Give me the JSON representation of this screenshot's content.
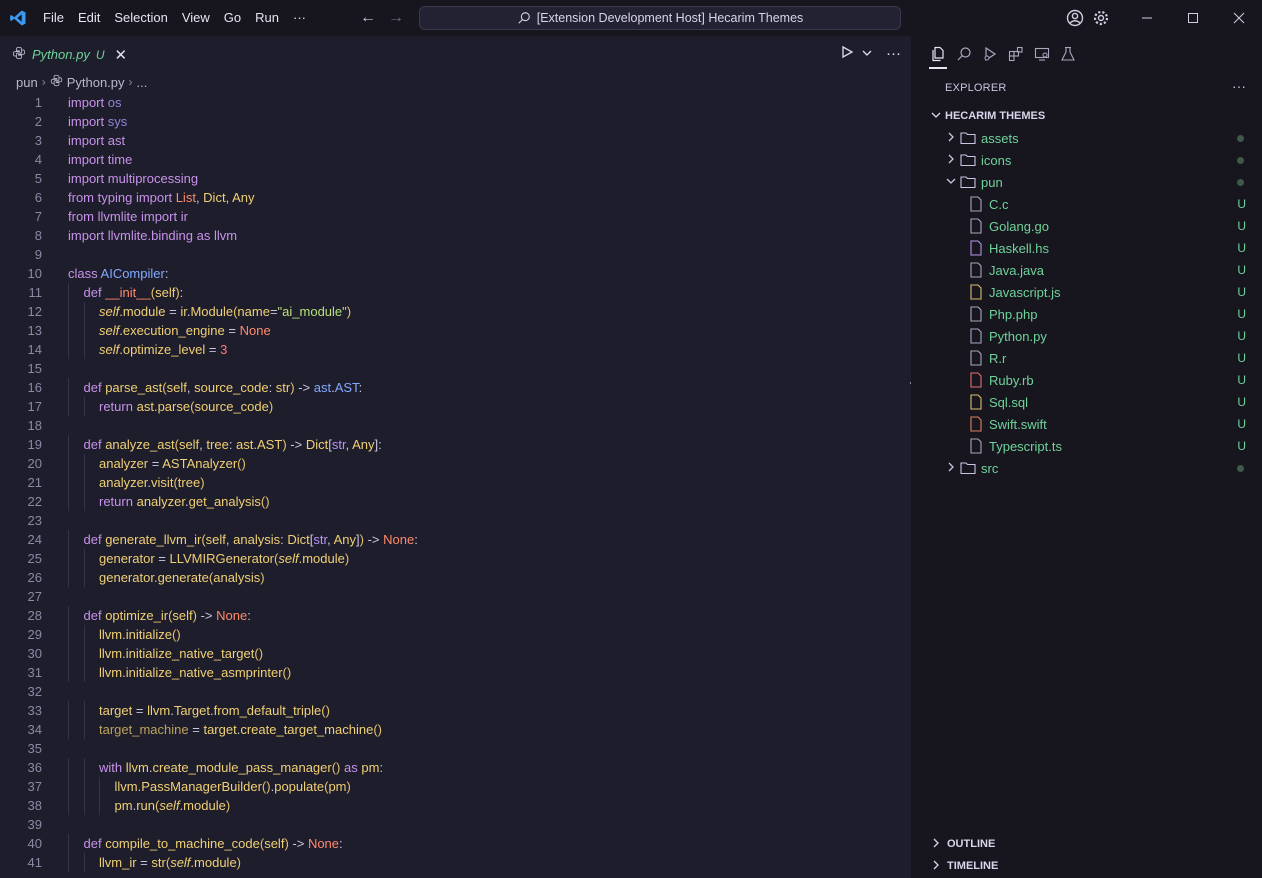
{
  "menu": [
    "File",
    "Edit",
    "Selection",
    "View",
    "Go",
    "Run",
    "···"
  ],
  "command_center": "[Extension Development Host] Hecarim Themes",
  "tab": {
    "label": "Python.py",
    "badge": "U"
  },
  "breadcrumb": [
    "pun",
    "Python.py",
    "..."
  ],
  "explorer": {
    "title": "EXPLORER",
    "root": "HECARIM THEMES",
    "items": [
      {
        "label": "assets",
        "type": "folder",
        "expanded": false
      },
      {
        "label": "icons",
        "type": "folder",
        "expanded": false
      },
      {
        "label": "pun",
        "type": "folder",
        "expanded": true
      },
      {
        "label": "C.c",
        "type": "file",
        "badge": "U"
      },
      {
        "label": "Golang.go",
        "type": "file",
        "badge": "U"
      },
      {
        "label": "Haskell.hs",
        "type": "file",
        "badge": "U"
      },
      {
        "label": "Java.java",
        "type": "file",
        "badge": "U"
      },
      {
        "label": "Javascript.js",
        "type": "file",
        "badge": "U"
      },
      {
        "label": "Php.php",
        "type": "file",
        "badge": "U"
      },
      {
        "label": "Python.py",
        "type": "file",
        "badge": "U"
      },
      {
        "label": "R.r",
        "type": "file",
        "badge": "U"
      },
      {
        "label": "Ruby.rb",
        "type": "file",
        "badge": "U"
      },
      {
        "label": "Sql.sql",
        "type": "file",
        "badge": "U"
      },
      {
        "label": "Swift.swift",
        "type": "file",
        "badge": "U"
      },
      {
        "label": "Typescript.ts",
        "type": "file",
        "badge": "U"
      },
      {
        "label": "src",
        "type": "folder",
        "expanded": false
      }
    ],
    "sections": [
      "OUTLINE",
      "TIMELINE"
    ]
  },
  "code_lines": [
    {
      "n": "1",
      "indent": 0,
      "t": [
        [
          "kw",
          "import"
        ],
        [
          "op",
          " "
        ],
        [
          "mod",
          "os"
        ]
      ]
    },
    {
      "n": "2",
      "indent": 0,
      "t": [
        [
          "kw",
          "import"
        ],
        [
          "op",
          " "
        ],
        [
          "mod",
          "sys"
        ]
      ]
    },
    {
      "n": "3",
      "indent": 0,
      "t": [
        [
          "kw",
          "import"
        ],
        [
          "op",
          " "
        ],
        [
          "kw",
          "ast"
        ]
      ]
    },
    {
      "n": "4",
      "indent": 0,
      "t": [
        [
          "kw",
          "import"
        ],
        [
          "op",
          " "
        ],
        [
          "kw",
          "time"
        ]
      ]
    },
    {
      "n": "5",
      "indent": 0,
      "t": [
        [
          "kw",
          "import"
        ],
        [
          "op",
          " "
        ],
        [
          "kw",
          "multiprocessing"
        ]
      ]
    },
    {
      "n": "6",
      "indent": 0,
      "t": [
        [
          "kw",
          "from"
        ],
        [
          "op",
          " "
        ],
        [
          "kw",
          "typing"
        ],
        [
          "op",
          " "
        ],
        [
          "kw",
          "import"
        ],
        [
          "op",
          " "
        ],
        [
          "nn",
          "List"
        ],
        [
          "op",
          ", "
        ],
        [
          "fn",
          "Dict"
        ],
        [
          "op",
          ", "
        ],
        [
          "fn",
          "Any"
        ]
      ]
    },
    {
      "n": "7",
      "indent": 0,
      "t": [
        [
          "kw",
          "from"
        ],
        [
          "op",
          " "
        ],
        [
          "kw",
          "llvmlite"
        ],
        [
          "op",
          " "
        ],
        [
          "kw",
          "import"
        ],
        [
          "op",
          " "
        ],
        [
          "kw",
          "ir"
        ]
      ]
    },
    {
      "n": "8",
      "indent": 0,
      "t": [
        [
          "kw",
          "import"
        ],
        [
          "op",
          " "
        ],
        [
          "kw",
          "llvmlite.binding"
        ],
        [
          "op",
          " "
        ],
        [
          "kw",
          "as"
        ],
        [
          "op",
          " "
        ],
        [
          "kw",
          "llvm"
        ]
      ]
    },
    {
      "n": "9",
      "indent": 0,
      "t": []
    },
    {
      "n": "10",
      "indent": 0,
      "t": [
        [
          "kw",
          "class"
        ],
        [
          "op",
          " "
        ],
        [
          "cls",
          "AICompiler"
        ],
        [
          "op",
          ":"
        ]
      ]
    },
    {
      "n": "11",
      "indent": 1,
      "t": [
        [
          "kw",
          "def"
        ],
        [
          "op",
          " "
        ],
        [
          "nn",
          "__init__"
        ],
        [
          "pl",
          "("
        ],
        [
          "pr",
          "self"
        ],
        [
          "pl",
          ")"
        ],
        [
          "op",
          ":"
        ]
      ]
    },
    {
      "n": "12",
      "indent": 2,
      "t": [
        [
          "self",
          "self"
        ],
        [
          "pr",
          ".module"
        ],
        [
          "op",
          " = "
        ],
        [
          "pr",
          "ir"
        ],
        [
          "op",
          "."
        ],
        [
          "pr",
          "Module"
        ],
        [
          "pl",
          "("
        ],
        [
          "pr",
          "name"
        ],
        [
          "op",
          "="
        ],
        [
          "str",
          "\"ai_module\""
        ],
        [
          "pl",
          ")"
        ]
      ]
    },
    {
      "n": "13",
      "indent": 2,
      "t": [
        [
          "self",
          "self"
        ],
        [
          "pr",
          ".execution_engine"
        ],
        [
          "op",
          " = "
        ],
        [
          "nn",
          "None"
        ]
      ]
    },
    {
      "n": "14",
      "indent": 2,
      "t": [
        [
          "self",
          "self"
        ],
        [
          "pr",
          ".optimize_level"
        ],
        [
          "op",
          " = "
        ],
        [
          "num",
          "3"
        ]
      ]
    },
    {
      "n": "15",
      "indent": 0,
      "t": []
    },
    {
      "n": "16",
      "indent": 1,
      "t": [
        [
          "kw",
          "def"
        ],
        [
          "op",
          " "
        ],
        [
          "fn",
          "parse_ast"
        ],
        [
          "pl",
          "("
        ],
        [
          "pr",
          "self"
        ],
        [
          "op",
          ", "
        ],
        [
          "pr",
          "source_code"
        ],
        [
          "op",
          ": "
        ],
        [
          "fn",
          "str"
        ],
        [
          "pl",
          ")"
        ],
        [
          "op",
          " -> "
        ],
        [
          "cls",
          "ast"
        ],
        [
          "op",
          "."
        ],
        [
          "cls",
          "AST"
        ],
        [
          "op",
          ":"
        ]
      ]
    },
    {
      "n": "17",
      "indent": 2,
      "t": [
        [
          "kw",
          "return"
        ],
        [
          "op",
          " "
        ],
        [
          "pr",
          "ast"
        ],
        [
          "op",
          "."
        ],
        [
          "fn",
          "parse"
        ],
        [
          "pl",
          "("
        ],
        [
          "pr",
          "source_code"
        ],
        [
          "pl",
          ")"
        ]
      ]
    },
    {
      "n": "18",
      "indent": 0,
      "t": []
    },
    {
      "n": "19",
      "indent": 1,
      "t": [
        [
          "kw",
          "def"
        ],
        [
          "op",
          " "
        ],
        [
          "fn",
          "analyze_ast"
        ],
        [
          "pl",
          "("
        ],
        [
          "pr",
          "self"
        ],
        [
          "op",
          ", "
        ],
        [
          "pr",
          "tree"
        ],
        [
          "op",
          ": "
        ],
        [
          "pr",
          "ast"
        ],
        [
          "op",
          "."
        ],
        [
          "pr",
          "AST"
        ],
        [
          "pl",
          ")"
        ],
        [
          "op",
          " -> "
        ],
        [
          "fn",
          "Dict"
        ],
        [
          "op",
          "["
        ],
        [
          "ty",
          "str"
        ],
        [
          "op",
          ", "
        ],
        [
          "fn",
          "Any"
        ],
        [
          "op",
          "]:"
        ]
      ]
    },
    {
      "n": "20",
      "indent": 2,
      "t": [
        [
          "pr",
          "analyzer"
        ],
        [
          "op",
          " = "
        ],
        [
          "fn",
          "ASTAnalyzer"
        ],
        [
          "pl",
          "()"
        ]
      ]
    },
    {
      "n": "21",
      "indent": 2,
      "t": [
        [
          "pr",
          "analyzer"
        ],
        [
          "op",
          "."
        ],
        [
          "fn",
          "visit"
        ],
        [
          "pl",
          "("
        ],
        [
          "pr",
          "tree"
        ],
        [
          "pl",
          ")"
        ]
      ]
    },
    {
      "n": "22",
      "indent": 2,
      "t": [
        [
          "kw",
          "return"
        ],
        [
          "op",
          " "
        ],
        [
          "pr",
          "analyzer"
        ],
        [
          "op",
          "."
        ],
        [
          "fn",
          "get_analysis"
        ],
        [
          "pl",
          "()"
        ]
      ]
    },
    {
      "n": "23",
      "indent": 0,
      "t": []
    },
    {
      "n": "24",
      "indent": 1,
      "t": [
        [
          "kw",
          "def"
        ],
        [
          "op",
          " "
        ],
        [
          "fn",
          "generate_llvm_ir"
        ],
        [
          "pl",
          "("
        ],
        [
          "pr",
          "self"
        ],
        [
          "op",
          ", "
        ],
        [
          "pr",
          "analysis"
        ],
        [
          "op",
          ": "
        ],
        [
          "fn",
          "Dict"
        ],
        [
          "op",
          "["
        ],
        [
          "ty",
          "str"
        ],
        [
          "op",
          ", "
        ],
        [
          "fn",
          "Any"
        ],
        [
          "op",
          "]"
        ],
        [
          "pl",
          ")"
        ],
        [
          "op",
          " -> "
        ],
        [
          "nn",
          "None"
        ],
        [
          "op",
          ":"
        ]
      ]
    },
    {
      "n": "25",
      "indent": 2,
      "t": [
        [
          "pr",
          "generator"
        ],
        [
          "op",
          " = "
        ],
        [
          "fn",
          "LLVMIRGenerator"
        ],
        [
          "pl",
          "("
        ],
        [
          "self",
          "self"
        ],
        [
          "pr",
          ".module"
        ],
        [
          "pl",
          ")"
        ]
      ]
    },
    {
      "n": "26",
      "indent": 2,
      "t": [
        [
          "pr",
          "generator"
        ],
        [
          "op",
          "."
        ],
        [
          "fn",
          "generate"
        ],
        [
          "pl",
          "("
        ],
        [
          "pr",
          "analysis"
        ],
        [
          "pl",
          ")"
        ]
      ]
    },
    {
      "n": "27",
      "indent": 0,
      "t": []
    },
    {
      "n": "28",
      "indent": 1,
      "t": [
        [
          "kw",
          "def"
        ],
        [
          "op",
          " "
        ],
        [
          "fn",
          "optimize_ir"
        ],
        [
          "pl",
          "("
        ],
        [
          "pr",
          "self"
        ],
        [
          "pl",
          ")"
        ],
        [
          "op",
          " -> "
        ],
        [
          "nn",
          "None"
        ],
        [
          "op",
          ":"
        ]
      ]
    },
    {
      "n": "29",
      "indent": 2,
      "t": [
        [
          "pr",
          "llvm"
        ],
        [
          "op",
          "."
        ],
        [
          "fn",
          "initialize"
        ],
        [
          "pl",
          "()"
        ]
      ]
    },
    {
      "n": "30",
      "indent": 2,
      "t": [
        [
          "pr",
          "llvm"
        ],
        [
          "op",
          "."
        ],
        [
          "fn",
          "initialize_native_target"
        ],
        [
          "pl",
          "()"
        ]
      ]
    },
    {
      "n": "31",
      "indent": 2,
      "t": [
        [
          "pr",
          "llvm"
        ],
        [
          "op",
          "."
        ],
        [
          "fn",
          "initialize_native_asmprinter"
        ],
        [
          "pl",
          "()"
        ]
      ]
    },
    {
      "n": "32",
      "indent": 0,
      "t": []
    },
    {
      "n": "33",
      "indent": 2,
      "t": [
        [
          "pr",
          "target"
        ],
        [
          "op",
          " = "
        ],
        [
          "pr",
          "llvm"
        ],
        [
          "op",
          "."
        ],
        [
          "pr",
          "Target"
        ],
        [
          "op",
          "."
        ],
        [
          "fn",
          "from_default_triple"
        ],
        [
          "pl",
          "()"
        ]
      ]
    },
    {
      "n": "34",
      "indent": 2,
      "t": [
        [
          "var",
          "target_machine"
        ],
        [
          "op",
          " = "
        ],
        [
          "pr",
          "target"
        ],
        [
          "op",
          "."
        ],
        [
          "fn",
          "create_target_machine"
        ],
        [
          "pl",
          "()"
        ]
      ]
    },
    {
      "n": "35",
      "indent": 0,
      "t": []
    },
    {
      "n": "36",
      "indent": 2,
      "t": [
        [
          "kw",
          "with"
        ],
        [
          "op",
          " "
        ],
        [
          "pr",
          "llvm"
        ],
        [
          "op",
          "."
        ],
        [
          "fn",
          "create_module_pass_manager"
        ],
        [
          "pl",
          "()"
        ],
        [
          "op",
          " "
        ],
        [
          "kw",
          "as"
        ],
        [
          "op",
          " "
        ],
        [
          "pr",
          "pm"
        ],
        [
          "op",
          ":"
        ]
      ]
    },
    {
      "n": "37",
      "indent": 3,
      "t": [
        [
          "pr",
          "llvm"
        ],
        [
          "op",
          "."
        ],
        [
          "fn",
          "PassManagerBuilder"
        ],
        [
          "pl",
          "()"
        ],
        [
          "op",
          "."
        ],
        [
          "fn",
          "populate"
        ],
        [
          "pl",
          "("
        ],
        [
          "pr",
          "pm"
        ],
        [
          "pl",
          ")"
        ]
      ]
    },
    {
      "n": "38",
      "indent": 3,
      "t": [
        [
          "pr",
          "pm"
        ],
        [
          "op",
          "."
        ],
        [
          "fn",
          "run"
        ],
        [
          "pl",
          "("
        ],
        [
          "self",
          "self"
        ],
        [
          "pr",
          ".module"
        ],
        [
          "pl",
          ")"
        ]
      ]
    },
    {
      "n": "39",
      "indent": 0,
      "t": []
    },
    {
      "n": "40",
      "indent": 1,
      "t": [
        [
          "kw",
          "def"
        ],
        [
          "op",
          " "
        ],
        [
          "fn",
          "compile_to_machine_code"
        ],
        [
          "pl",
          "("
        ],
        [
          "pr",
          "self"
        ],
        [
          "pl",
          ")"
        ],
        [
          "op",
          " -> "
        ],
        [
          "nn",
          "None"
        ],
        [
          "op",
          ":"
        ]
      ]
    },
    {
      "n": "41",
      "indent": 2,
      "t": [
        [
          "pr",
          "llvm_ir"
        ],
        [
          "op",
          " = "
        ],
        [
          "fn",
          "str"
        ],
        [
          "pl",
          "("
        ],
        [
          "self",
          "self"
        ],
        [
          "pr",
          ".module"
        ],
        [
          "pl",
          ")"
        ]
      ]
    }
  ]
}
